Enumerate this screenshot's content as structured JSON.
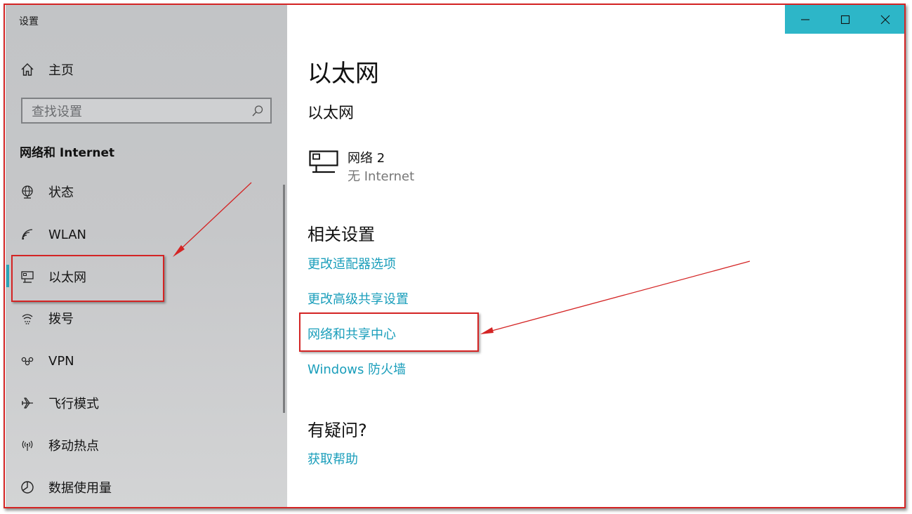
{
  "window": {
    "title": "设置"
  },
  "sidebar": {
    "home_label": "主页",
    "search_placeholder": "查找设置",
    "section_label": "网络和 Internet",
    "items": [
      {
        "label": "状态",
        "icon": "globe-icon"
      },
      {
        "label": "WLAN",
        "icon": "wifi-icon"
      },
      {
        "label": "以太网",
        "icon": "ethernet-icon",
        "selected": true
      },
      {
        "label": "拨号",
        "icon": "dialup-icon"
      },
      {
        "label": "VPN",
        "icon": "vpn-icon"
      },
      {
        "label": "飞行模式",
        "icon": "airplane-icon"
      },
      {
        "label": "移动热点",
        "icon": "hotspot-icon"
      },
      {
        "label": "数据使用量",
        "icon": "data-usage-icon"
      }
    ]
  },
  "main": {
    "title": "以太网",
    "subtitle": "以太网",
    "network": {
      "name": "网络  2",
      "status": "无 Internet"
    },
    "related_heading": "相关设置",
    "related_links": [
      "更改适配器选项",
      "更改高级共享设置",
      "网络和共享中心",
      "Windows 防火墙"
    ],
    "help_heading": "有疑问?",
    "help_link": "获取帮助"
  },
  "colors": {
    "accent": "#2db6c8",
    "link": "#1a9ebb",
    "annotation": "#d42424",
    "sidebar_bg": "#c4c5c7"
  }
}
